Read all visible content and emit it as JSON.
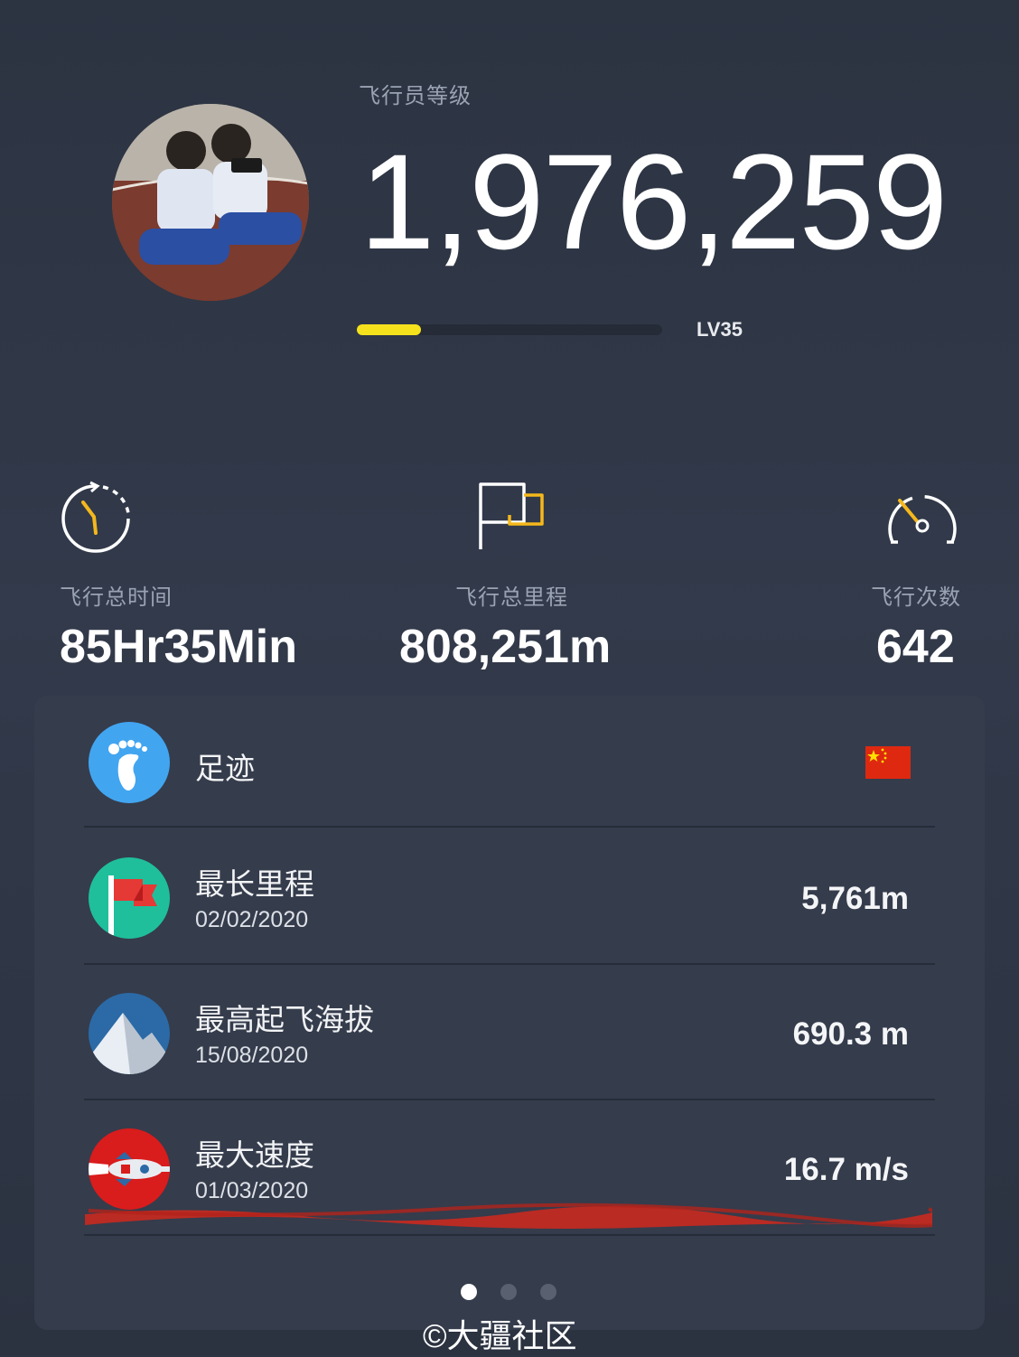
{
  "header": {
    "rank_label": "飞行员等级",
    "points": "1,976,259",
    "level": "LV35",
    "progress_fraction": 0.21
  },
  "stats": {
    "flight_time": {
      "label": "飞行总时间",
      "value": "85Hr35Min",
      "icon": "stopwatch-icon"
    },
    "distance": {
      "label": "飞行总里程",
      "value": "808,251m",
      "icon": "flag-icon"
    },
    "flights": {
      "label": "飞行次数",
      "value": "642",
      "icon": "speedometer-icon"
    }
  },
  "records": {
    "footprint": {
      "title": "足迹",
      "icon": "footprint-icon",
      "badge_icon": "china-flag-icon"
    },
    "longest_distance": {
      "title": "最长里程",
      "date": "02/02/2020",
      "value": "5,761m",
      "icon": "red-flag-icon"
    },
    "highest_altitude": {
      "title": "最高起飞海拔",
      "date": "15/08/2020",
      "value": "690.3 m",
      "icon": "mountain-icon"
    },
    "max_speed": {
      "title": "最大速度",
      "date": "01/03/2020",
      "value": "16.7 m/s",
      "icon": "rocket-icon"
    }
  },
  "pager": {
    "pages": 3,
    "active": 0
  },
  "watermark": "©大疆社区",
  "colors": {
    "accent_yellow": "#f5e21c",
    "footprint_blue": "#42a5f0",
    "flag_green": "#1fbf9c",
    "mountain_blue": "#2b6aa6",
    "rocket_red": "#d91c1c"
  }
}
